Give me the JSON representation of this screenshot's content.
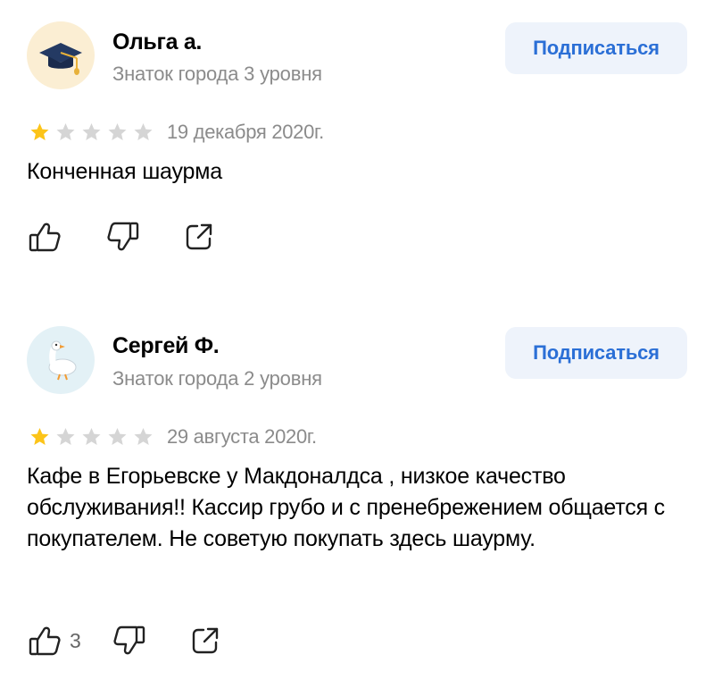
{
  "reviews": [
    {
      "author": "Ольга а.",
      "level": "Знаток города 3 уровня",
      "subscribe_label": "Подписаться",
      "avatar_icon": "graduation-cap-icon",
      "avatar_bg": "#fbeed3",
      "rating": 1,
      "max_rating": 5,
      "date": "19 декабря 2020г.",
      "text": "Конченная шаурма",
      "likes": ""
    },
    {
      "author": "Сергей Ф.",
      "level": "Знаток города 2 уровня",
      "subscribe_label": "Подписаться",
      "avatar_icon": "goose-icon",
      "avatar_bg": "#e3f1f6",
      "rating": 1,
      "max_rating": 5,
      "date": "29 августа 2020г.",
      "text": "Кафе в Егорьевске у Макдоналдса , низкое качество обслуживания!! Кассир грубо  и с пренебрежением общается с покупателем. Не советую покупать здесь шаурму.",
      "likes": "3"
    }
  ],
  "colors": {
    "star_active": "#fcc419",
    "star_inactive": "#d5d5d5",
    "accent": "#2b6fd6",
    "button_bg": "#eef3fb",
    "muted_text": "#8b8b8b"
  }
}
